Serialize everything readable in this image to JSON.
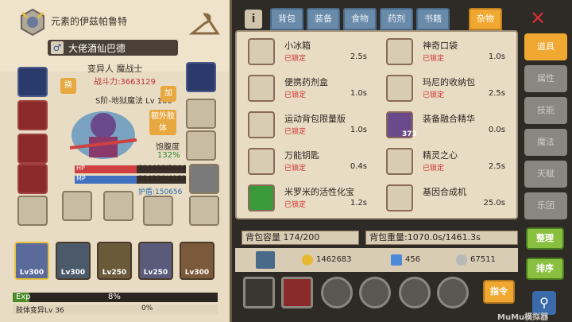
{
  "header": {
    "guild_name": "元素的伊兹帕鲁特",
    "character_name": "大佬酒仙巴德",
    "gender_symbol": "♂",
    "race_class": "变异人 魔战士",
    "power": "战斗力:3663129",
    "skill_line": "S阶-地狱魔法 Lv 100"
  },
  "buttons": {
    "swap": "换",
    "add": "加",
    "extra_limb": "额外肢体"
  },
  "satiety": {
    "label": "饱腹度",
    "value": "132%"
  },
  "stats": {
    "hp_label": "HP",
    "hp_value": "204499/2044",
    "mp_label": "MP",
    "mp_value": "314220/4189",
    "shield": "护盾:150656"
  },
  "pets": [
    {
      "level": "Lv300",
      "selected": true
    },
    {
      "level": "Lv300",
      "selected": false
    },
    {
      "level": "Lv250",
      "selected": false
    },
    {
      "level": "Lv250",
      "selected": false
    },
    {
      "level": "Lv300",
      "selected": false
    }
  ],
  "exp": {
    "label": "Exp",
    "percent": "8%"
  },
  "limb": {
    "label": "肢体变异Lv 36",
    "percent": "0%"
  },
  "tabs": [
    "背包",
    "装备",
    "食物",
    "药剂",
    "书籍",
    "杂物"
  ],
  "active_tab": "杂物",
  "items": [
    {
      "name": "小冰箱",
      "status": "已锁定",
      "time": "2.5s"
    },
    {
      "name": "神奇口袋",
      "status": "已锁定",
      "time": "1.0s"
    },
    {
      "name": "便携药剂盒",
      "status": "已锁定",
      "time": "1.0s"
    },
    {
      "name": "玛尼的收纳包",
      "status": "已锁定",
      "time": "2.5s"
    },
    {
      "name": "运动背包限量版",
      "status": "已锁定",
      "time": "1.0s"
    },
    {
      "name": "装备融合精华",
      "status": "",
      "time": "0.0s",
      "count": "373"
    },
    {
      "name": "万能钥匙",
      "status": "已锁定",
      "time": "0.4s"
    },
    {
      "name": "精灵之心",
      "status": "已锁定",
      "time": "2.5s"
    },
    {
      "name": "米罗米的活性化宝",
      "status": "已锁定",
      "time": "1.2s"
    },
    {
      "name": "基因合成机",
      "status": "",
      "time": "25.0s"
    }
  ],
  "capacity": "背包容量 174/200",
  "weight": "背包重量:1070.0s/1461.3s",
  "currency": {
    "gold": "1462683",
    "gem": "456",
    "silver": "67511"
  },
  "command_button": "指令",
  "side_tabs": [
    "道具",
    "属性",
    "技能",
    "魔法",
    "天赋",
    "乐团"
  ],
  "active_side_tab": "道具",
  "side_buttons": {
    "sort": "整理",
    "order": "排序"
  },
  "watermark": "MuMu模拟器",
  "colors": {
    "accent_orange": "#f0a830",
    "tab_blue": "#6a8aaa",
    "locked_red": "#d03030",
    "action_green": "#8ac040"
  }
}
